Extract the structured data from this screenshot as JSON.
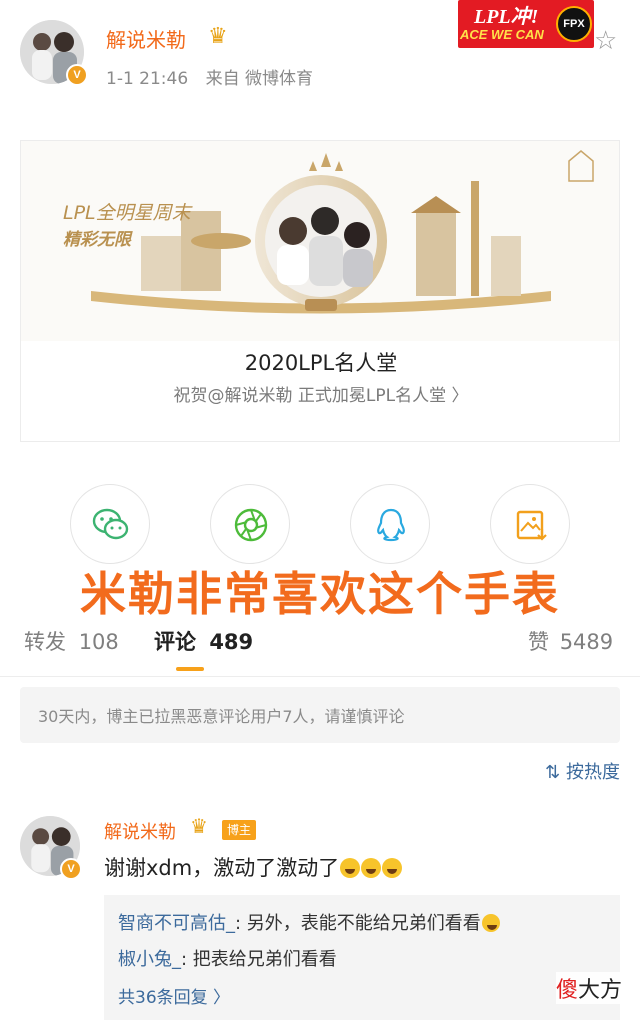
{
  "post": {
    "author": "解说米勒",
    "verified": "V",
    "time": "1-1 21:46",
    "source": "来自 微博体育"
  },
  "fan_banner": {
    "line1": "LPL冲!",
    "line2": "ACE WE CAN",
    "team": "FPX"
  },
  "card": {
    "art_line1": "LPL全明星周末",
    "art_line2": "精彩无限",
    "title": "2020LPL名人堂",
    "subtitle": "祝贺@解说米勒 正式加冕LPL名人堂 〉"
  },
  "share_icons": [
    "wechat-icon",
    "moments-icon",
    "qq-icon",
    "save-image-icon"
  ],
  "overlay_text": "米勒非常喜欢这个手表",
  "tabs": {
    "repost_label": "转发",
    "repost_count": "108",
    "comment_label": "评论",
    "comment_count": "489",
    "like_label": "赞",
    "like_count": "5489"
  },
  "notice": "30天内，博主已拉黑恶意评论用户7人，请谨慎评论",
  "sort_label": "按热度",
  "comment": {
    "author": "解说米勒",
    "badge": "博主",
    "text": "谢谢xdm，激动了激动了",
    "replies": [
      {
        "user": "智商不可高估_",
        "text": ": 另外，表能不能给兄弟们看看"
      },
      {
        "user": "椒小兔_",
        "text": ": 把表给兄弟们看看"
      }
    ],
    "more_replies": "共36条回复 〉"
  },
  "watermark": {
    "red": "傻",
    "black": "大方"
  },
  "colors": {
    "accent_orange": "#f26a1b",
    "link_blue": "#3c6a9c",
    "gold": "#f7a11a"
  }
}
